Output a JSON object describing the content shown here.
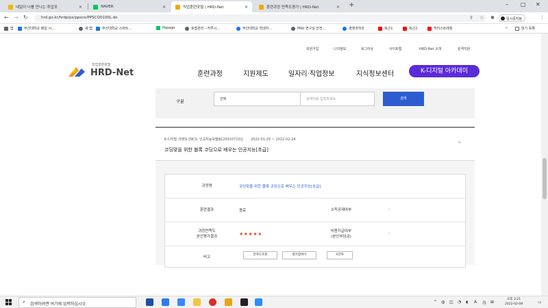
{
  "browser": {
    "tabs": [
      {
        "label": "내일이 나를 만나는 취업포",
        "favicon_color": "#f4b400",
        "active": false
      },
      {
        "label": "NAVER",
        "favicon_color": "#03c75a",
        "active": false
      },
      {
        "label": "직업훈련포털 | HRD-Net",
        "favicon_color": "#f2a900",
        "active": true
      },
      {
        "label": "훈련과정 만족도평가 | HRD-Net",
        "favicon_color": "#f2a900",
        "active": false
      }
    ],
    "new_tab": "+",
    "window_controls": {
      "minimize": "–",
      "maximize": "□",
      "close": "✕"
    },
    "url": "hrd.go.kr/hrdp/ps/ppsco/PPSCO0100L.do",
    "profile_label": "일시중지됨",
    "bookmarks": [
      {
        "label": "앱",
        "color": "#5f6368"
      },
      {
        "label": "부산대학교 메일 시...",
        "color": "#1a73e8"
      },
      {
        "label": "새 탭",
        "color": "#5f6368"
      },
      {
        "label": "부산대학교 스마트...",
        "color": "#1a73e8"
      },
      {
        "label": "Papago",
        "color": "#03c75a"
      },
      {
        "label": "포접관리 - 카루시...",
        "color": "#5f6368"
      },
      {
        "label": "부산대학교 학생지...",
        "color": "#1a73e8"
      },
      {
        "label": "PNU 연구실 안전...",
        "color": "#5f6368"
      },
      {
        "label": "경영과학과",
        "color": "#1a73e8"
      },
      {
        "label": "복근1",
        "color": "#ff0000"
      },
      {
        "label": "복근2",
        "color": "#ff0000"
      },
      {
        "label": "허리스트레칭",
        "color": "#ff0000"
      }
    ],
    "reading_list": "읽기 목록",
    "other_bookmarks": "»"
  },
  "site": {
    "util_links": [
      "회원가입",
      "나의정보",
      "로그아웃",
      "사이트맵",
      "HRD-Net 소개",
      "원격지원"
    ],
    "logo_sub": "직업훈련포털",
    "logo_main": "HRD-Net",
    "nav": [
      "훈련과정",
      "지원제도",
      "일자리·직업정보",
      "지식정보센터"
    ],
    "nav_highlight": "K-디지털 아카데미",
    "accent_color": "#5b2bd8",
    "search": {
      "label": "구분",
      "select_value": "선택",
      "input_placeholder": "검색어를 입력하세요.",
      "button": "검색",
      "button_color": "#2d5ccf"
    },
    "course": {
      "meta": "K-디지털 크레딧 [NCS: 인공지능모델링(20010710)]",
      "dates": "2022-01-25 ~ 2022-02-24",
      "title": "코딩맞을 위한 블록 코딩으로 배우는 인공지능[초급]",
      "detail": {
        "course_name_label": "과정명",
        "course_name_value": "코딩맞을 위한 블록 코딩으로 배우는 인공지능[초급]",
        "status_label": "훈련결과",
        "status_value": "종료",
        "employment_label": "소득공제여부",
        "employment_value": "-",
        "rating_label": "과정만족도\n본인평가결과",
        "rating_stars": 5,
        "rating_display": "★★★★★",
        "cost_label": "비용지급여부\n(본인부담금)",
        "cost_value": "-",
        "remark_label": "비고",
        "buttons": [
          "만족도조회",
          "평가참여기",
          "사진투"
        ]
      }
    }
  },
  "taskbar": {
    "search_placeholder": "검색하려면 여기에 입력하십시오.",
    "time": "오후 3:21",
    "date": "2022-02-08",
    "tray_lang": "A"
  }
}
